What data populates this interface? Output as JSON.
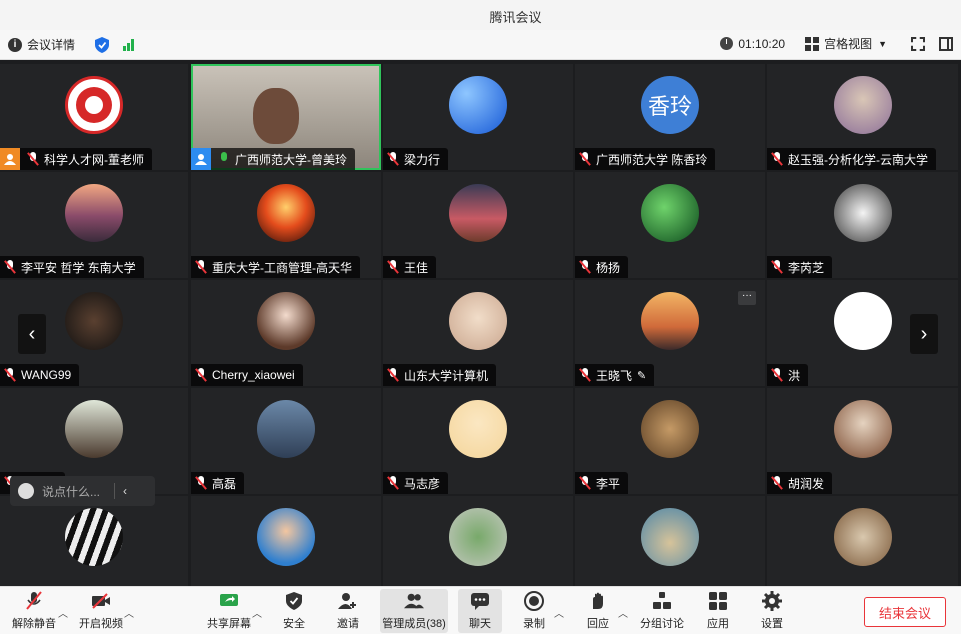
{
  "window": {
    "title": "腾讯会议"
  },
  "infobar": {
    "meeting_details": "会议详情",
    "timer": "01:10:20",
    "view_mode": "宫格视图"
  },
  "participants": [
    {
      "name": "科学人才网-董老师",
      "badge": "host",
      "avatar_type": "logo"
    },
    {
      "name": "广西师范大学-曾美玲",
      "badge": "cohost",
      "avatar_type": "video",
      "mic": "on"
    },
    {
      "name": "梁力行",
      "avatar_type": "image"
    },
    {
      "name": "广西师范大学 陈香玲",
      "avatar_type": "text",
      "avatar_text": "香玲"
    },
    {
      "name": "赵玉强-分析化学-云南大学",
      "avatar_type": "image"
    },
    {
      "name": "李平安 哲学 东南大学",
      "avatar_type": "image"
    },
    {
      "name": "重庆大学-工商管理-高天华",
      "avatar_type": "image"
    },
    {
      "name": "王佳",
      "avatar_type": "image"
    },
    {
      "name": "杨扬",
      "avatar_type": "image"
    },
    {
      "name": "李芮芝",
      "avatar_type": "image"
    },
    {
      "name": "WANG99",
      "avatar_type": "image"
    },
    {
      "name": "Cherry_xiaowei",
      "avatar_type": "image"
    },
    {
      "name": "山东大学计算机",
      "avatar_type": "image"
    },
    {
      "name": "王晓飞",
      "avatar_type": "image",
      "editing": true
    },
    {
      "name": "洪",
      "avatar_type": "image"
    },
    {
      "name": "赵明明",
      "avatar_type": "image"
    },
    {
      "name": "高磊",
      "avatar_type": "image"
    },
    {
      "name": "马志彦",
      "avatar_type": "image"
    },
    {
      "name": "李平",
      "avatar_type": "image"
    },
    {
      "name": "胡润发",
      "avatar_type": "image"
    },
    {
      "name": "",
      "avatar_type": "image"
    },
    {
      "name": "",
      "avatar_type": "image"
    },
    {
      "name": "",
      "avatar_type": "image"
    },
    {
      "name": "",
      "avatar_type": "image"
    },
    {
      "name": "",
      "avatar_type": "image"
    }
  ],
  "chat_input": {
    "placeholder": "说点什么..."
  },
  "toolbar": {
    "unmute": "解除静音",
    "start_video": "开启视频",
    "share_screen": "共享屏幕",
    "security": "安全",
    "invite": "邀请",
    "manage_members": "管理成员(38)",
    "chat": "聊天",
    "record": "录制",
    "react": "回应",
    "breakout": "分组讨论",
    "apps": "应用",
    "settings": "设置",
    "end_meeting": "结束会议"
  },
  "colors": {
    "accent_green": "#30c45b",
    "end_red": "#e9353a",
    "host_orange": "#f08a24",
    "cohost_blue": "#2d8cf0"
  }
}
